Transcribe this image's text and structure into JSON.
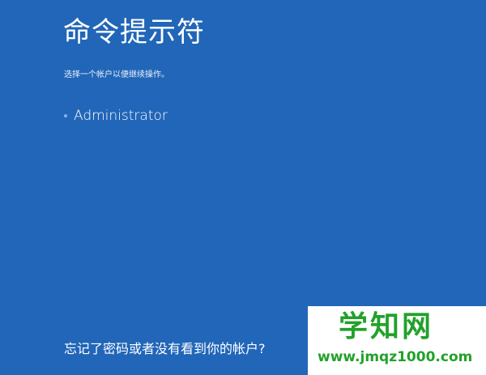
{
  "window": {
    "title": "命令提示符",
    "subtitle": "选择一个帐户以便继续操作。"
  },
  "accounts": [
    {
      "name": "Administrator"
    }
  ],
  "links": {
    "forgot_password": "忘记了密码或者没有看到你的帐户?"
  },
  "watermark": {
    "title": "学知网",
    "url": "www.jmqz1000.com"
  },
  "colors": {
    "background": "#2166b8",
    "text": "#ffffff",
    "bullet": "#7fb3f0",
    "watermark_green": "#22a12a"
  }
}
